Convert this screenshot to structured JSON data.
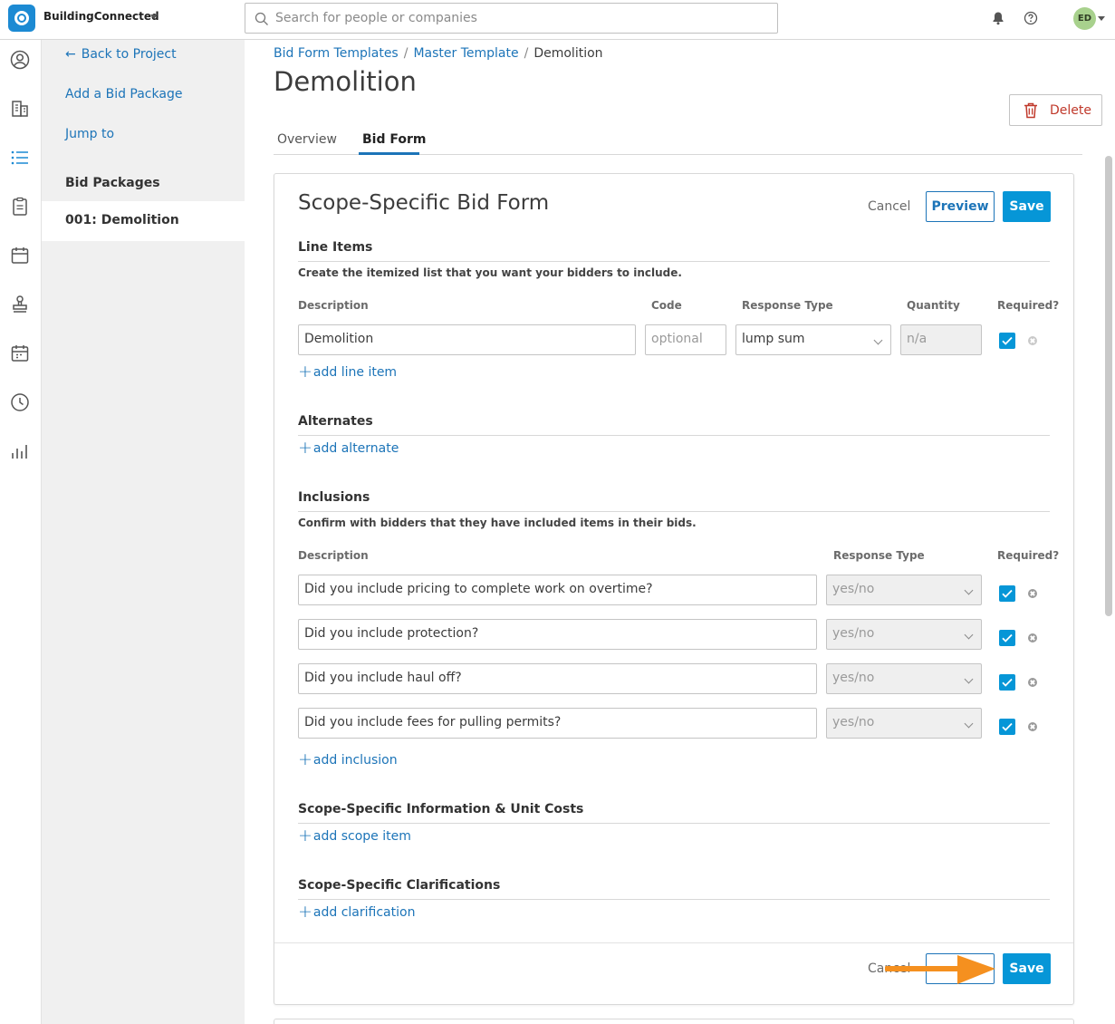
{
  "app": {
    "company_name": "BuildingConnected",
    "search_placeholder": "Search for people or companies",
    "user_initials": "ED"
  },
  "rail": {
    "icons": [
      "user-circle-icon",
      "building-icon",
      "list-icon",
      "clipboard-icon",
      "calendar-icon",
      "stamp-icon",
      "calendar-check-icon",
      "clock-icon",
      "bar-chart-icon"
    ]
  },
  "left_nav": {
    "back_label": "Back to Project",
    "add_package_label": "Add a Bid Package",
    "jump_label": "Jump to",
    "packages_heading": "Bid Packages",
    "active_package": "001: Demolition"
  },
  "breadcrumb": {
    "item1": "Bid Form Templates",
    "item2": "Master Template",
    "current": "Demolition",
    "separator": "/"
  },
  "page": {
    "title": "Demolition",
    "delete_label": "Delete"
  },
  "tabs": {
    "overview": "Overview",
    "bid_form": "Bid Form"
  },
  "form": {
    "title": "Scope-Specific Bid Form",
    "cancel_label": "Cancel",
    "preview_label": "Preview",
    "save_label": "Save",
    "line_items": {
      "title": "Line Items",
      "description": "Create the itemized list that you want your bidders to include.",
      "headers": {
        "description": "Description",
        "code": "Code",
        "response_type": "Response Type",
        "quantity": "Quantity",
        "required": "Required?"
      },
      "row": {
        "description": "Demolition",
        "code_placeholder": "optional",
        "response_type": "lump sum",
        "quantity": "n/a",
        "required": true
      },
      "add_label": "add line item"
    },
    "alternates": {
      "title": "Alternates",
      "add_label": "add alternate"
    },
    "inclusions": {
      "title": "Inclusions",
      "description": "Confirm with bidders that they have included items in their bids.",
      "headers": {
        "description": "Description",
        "response_type": "Response Type",
        "required": "Required?"
      },
      "rows": [
        {
          "description": "Did you include pricing to complete work on overtime?",
          "response_type": "yes/no",
          "required": true
        },
        {
          "description": "Did you include protection?",
          "response_type": "yes/no",
          "required": true
        },
        {
          "description": "Did you include haul off?",
          "response_type": "yes/no",
          "required": true
        },
        {
          "description": "Did you include fees for pulling permits?",
          "response_type": "yes/no",
          "required": true
        }
      ],
      "add_label": "add inclusion"
    },
    "scope_info": {
      "title": "Scope-Specific Information & Unit Costs",
      "add_label": "add scope item"
    },
    "clarifications": {
      "title": "Scope-Specific Clarifications",
      "add_label": "add clarification"
    },
    "footer": {
      "cancel_label": "Cancel",
      "save_label": "Save"
    }
  },
  "colors": {
    "accent": "#0696d7",
    "link": "#1c74b8",
    "danger": "#c0392b",
    "annotation_arrow": "#f5901f"
  }
}
